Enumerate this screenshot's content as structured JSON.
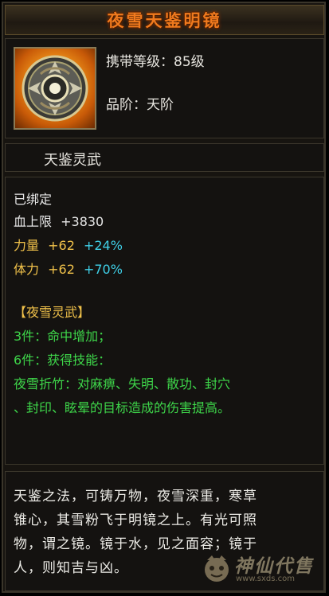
{
  "title": "夜雪天鉴明镜",
  "header": {
    "level_label": "携带等级：85级",
    "tier_label": "品阶：天阶"
  },
  "category": "天鉴灵武",
  "stats": {
    "bound": "已绑定",
    "hp_label": "血上限",
    "hp_value": "+3830",
    "str_label": "力量",
    "str_value": "+62",
    "str_percent": "+24%",
    "con_label": "体力",
    "con_value": "+62",
    "con_percent": "+70%"
  },
  "set": {
    "name": "【夜雪灵武】",
    "bonus3": "3件：命中增加；",
    "bonus6": "6件：获得技能：",
    "skill_line1": "夜雪折竹：对麻痹、失明、散功、封穴",
    "skill_line2": "、封印、眩晕的目标造成的伤害提高。"
  },
  "description": [
    "天鉴之法，可铸万物，夜雪深重，寒草",
    "锥心，其雪粉飞于明镜之上。有光可照",
    "物，谓之镜。镜于水，见之面容；镜于",
    "人，则知吉与凶。"
  ],
  "watermark": {
    "text": "神仙代售",
    "url": "www.sxds.com"
  },
  "icons": {
    "item": "mirror-disc-icon",
    "watermark_logo": "mascot-logo-icon"
  },
  "colors": {
    "title": "#f07a1e",
    "gold": "#f0c14a",
    "cyan": "#3fd0e8",
    "green": "#3ed64a"
  }
}
